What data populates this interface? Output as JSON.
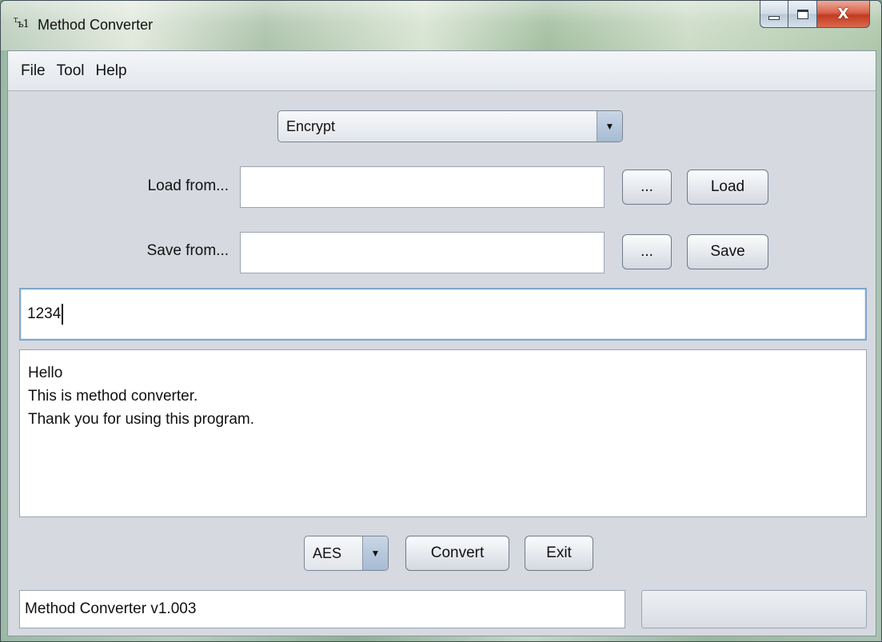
{
  "window": {
    "title": "Method Converter",
    "icon_text": "Tb1"
  },
  "menu": {
    "items": [
      "File",
      "Tool",
      "Help"
    ]
  },
  "mode_select": {
    "selected": "Encrypt"
  },
  "load_row": {
    "label": "Load from...",
    "value": "",
    "browse_label": "...",
    "action_label": "Load"
  },
  "save_row": {
    "label": "Save from...",
    "value": "",
    "browse_label": "...",
    "action_label": "Save"
  },
  "key_field": {
    "value": "1234"
  },
  "text_area": {
    "lines": [
      "Hello",
      "This is method converter.",
      "Thank you for using this program."
    ]
  },
  "algorithm_select": {
    "selected": "AES"
  },
  "buttons": {
    "convert": "Convert",
    "exit": "Exit"
  },
  "status": {
    "text": "Method Converter v1.003"
  },
  "icons": {
    "dropdown": "▼",
    "close": "X"
  }
}
